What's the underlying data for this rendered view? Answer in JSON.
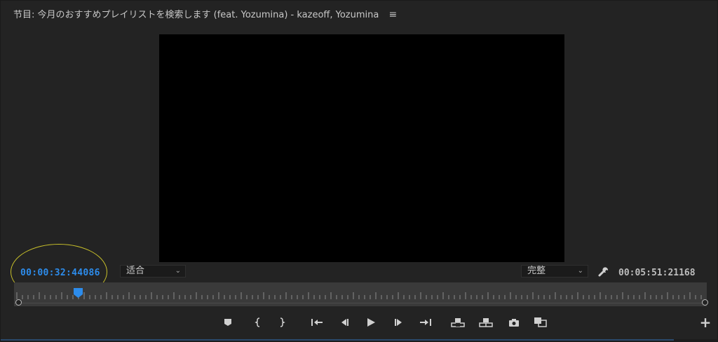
{
  "panel": {
    "title": "节目: 今月のおすすめプレイリストを検索します (feat. Yozumina) - kazeoff, Yozumina",
    "menu_icon": "≡"
  },
  "timecode": {
    "current": "00:00:32:44086",
    "duration": "00:05:51:21168"
  },
  "fit_dropdown": {
    "value": "适合"
  },
  "quality_dropdown": {
    "value": "完整"
  },
  "playhead_position": 0.093,
  "transport": [
    {
      "name": "add-marker-button",
      "icon": "marker-icon"
    },
    {
      "name": "mark-in-button",
      "icon": "mark-in-icon"
    },
    {
      "name": "mark-out-button",
      "icon": "mark-out-icon"
    },
    {
      "name": "go-to-in-button",
      "icon": "go-to-in-icon"
    },
    {
      "name": "step-back-button",
      "icon": "step-back-icon"
    },
    {
      "name": "play-button",
      "icon": "play-icon"
    },
    {
      "name": "step-forward-button",
      "icon": "step-forward-icon"
    },
    {
      "name": "go-to-out-button",
      "icon": "go-to-out-icon"
    },
    {
      "name": "lift-button",
      "icon": "lift-icon"
    },
    {
      "name": "extract-button",
      "icon": "extract-icon"
    },
    {
      "name": "export-frame-button",
      "icon": "camera-icon"
    },
    {
      "name": "comparison-view-button",
      "icon": "comparison-icon"
    }
  ],
  "colors": {
    "accent": "#2d8ceb",
    "annotation": "#c9c12a",
    "background": "#232323"
  }
}
